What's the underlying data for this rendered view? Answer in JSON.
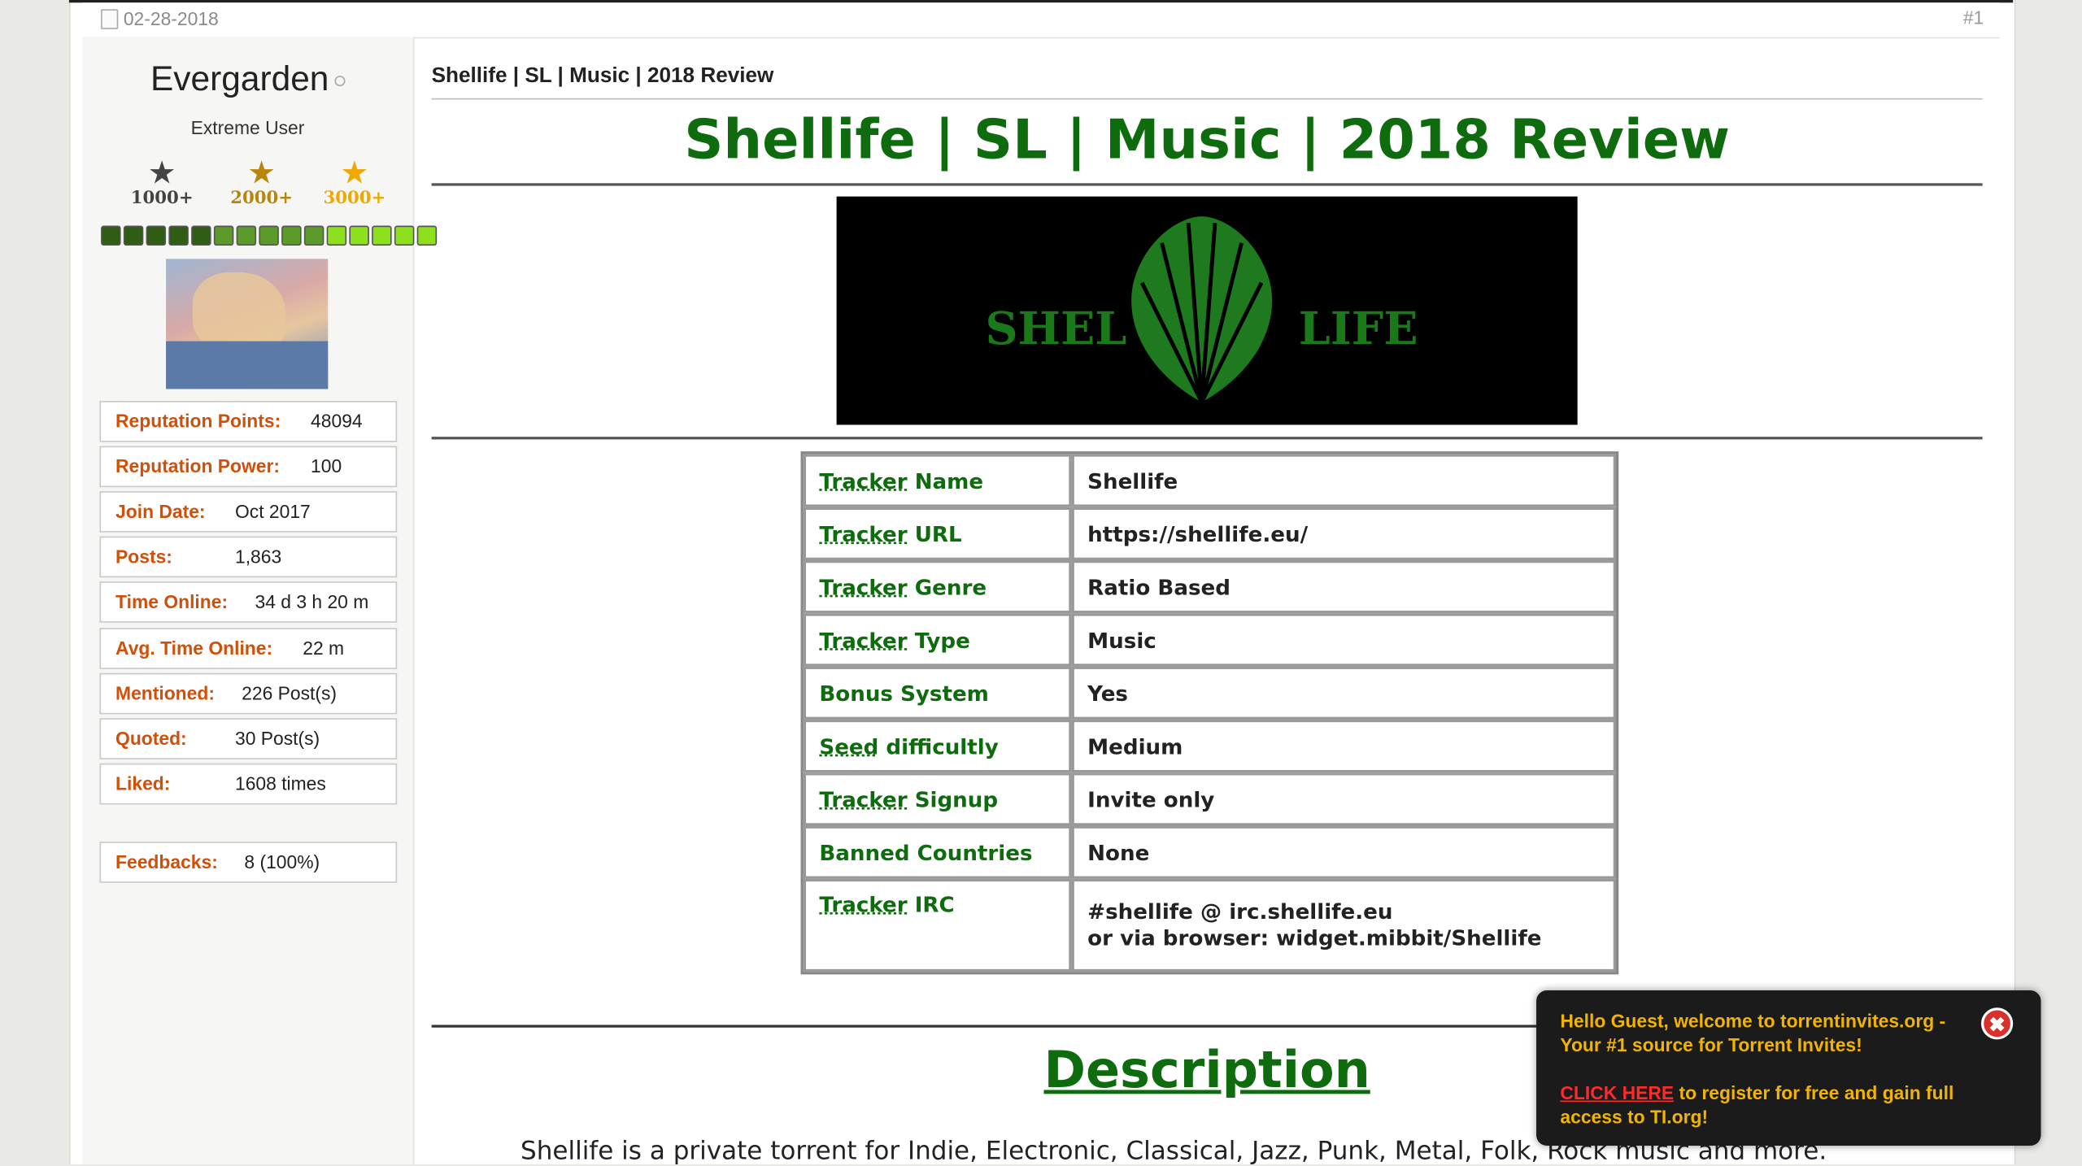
{
  "post": {
    "date": "02-28-2018",
    "number": "#1"
  },
  "user": {
    "name": "Evergarden",
    "title": "Extreme User",
    "awards": [
      {
        "label": "1000+",
        "color": "#444444"
      },
      {
        "label": "2000+",
        "color": "#b8860b"
      },
      {
        "label": "3000+",
        "color": "#f0a800"
      }
    ],
    "rep_bar_colors": [
      "#2f5d13",
      "#2f5d13",
      "#2f5d13",
      "#2f5d13",
      "#2f5d13",
      "#5c9a2a",
      "#5c9a2a",
      "#5c9a2a",
      "#5c9a2a",
      "#5c9a2a",
      "#8ee01c",
      "#8ee01c",
      "#8ee01c",
      "#8ee01c",
      "#8ee01c"
    ],
    "stats": [
      {
        "key": "Reputation Points:",
        "value": "48094"
      },
      {
        "key": "Reputation Power:",
        "value": "100"
      },
      {
        "key": "Join Date:",
        "value": "Oct 2017"
      },
      {
        "key": "Posts:",
        "value": "1,863"
      },
      {
        "key": "Time Online:",
        "value": "34 d 3 h 20 m"
      },
      {
        "key": "Avg. Time Online:",
        "value": "22 m"
      },
      {
        "key": "Mentioned:",
        "value": "226 Post(s)"
      },
      {
        "key": "Quoted:",
        "value": "30 Post(s)"
      },
      {
        "key": "Liked:",
        "value": "1608 times"
      }
    ],
    "feedback": {
      "key": "Feedbacks:",
      "value": "8 (100%)"
    }
  },
  "content": {
    "post_title": "Shellife | SL | Music | 2018 Review",
    "big_title": "Shellife | SL | Music | 2018 Review",
    "banner": {
      "left": "SHEL",
      "right": "LIFE"
    },
    "tracker_rows": [
      {
        "pre": "Tracker",
        "key": " Name",
        "value": "Shellife"
      },
      {
        "pre": "Tracker",
        "key": " URL",
        "value": "https://shellife.eu/"
      },
      {
        "pre": "Tracker",
        "key": " Genre",
        "value": "Ratio Based"
      },
      {
        "pre": "Tracker",
        "key": " Type",
        "value": "Music"
      },
      {
        "pre": "",
        "key": "Bonus System",
        "value": "Yes"
      },
      {
        "pre": "Seed",
        "key": " difficultly",
        "value": "Medium"
      },
      {
        "pre": "Tracker",
        "key": " Signup",
        "value": "Invite only"
      },
      {
        "pre": "",
        "key": "Banned Countries",
        "value": "None"
      },
      {
        "pre": "Tracker",
        "key": " IRC",
        "value": "#shellife @ irc.shellife.eu",
        "value2": "or via browser: widget.mibbit/Shellife"
      }
    ],
    "description_heading": "Description",
    "description_text": "Shellife is a private torrent for Indie, Electronic, Classical, Jazz, Punk, Metal, Folk, Rock music and more."
  },
  "popup": {
    "line1": "Hello Guest, welcome to torrentinvites.org - Your #1 source for Torrent Invites!",
    "link": "CLICK HERE",
    "line2": " to register for free and gain full access to TI.org!"
  }
}
